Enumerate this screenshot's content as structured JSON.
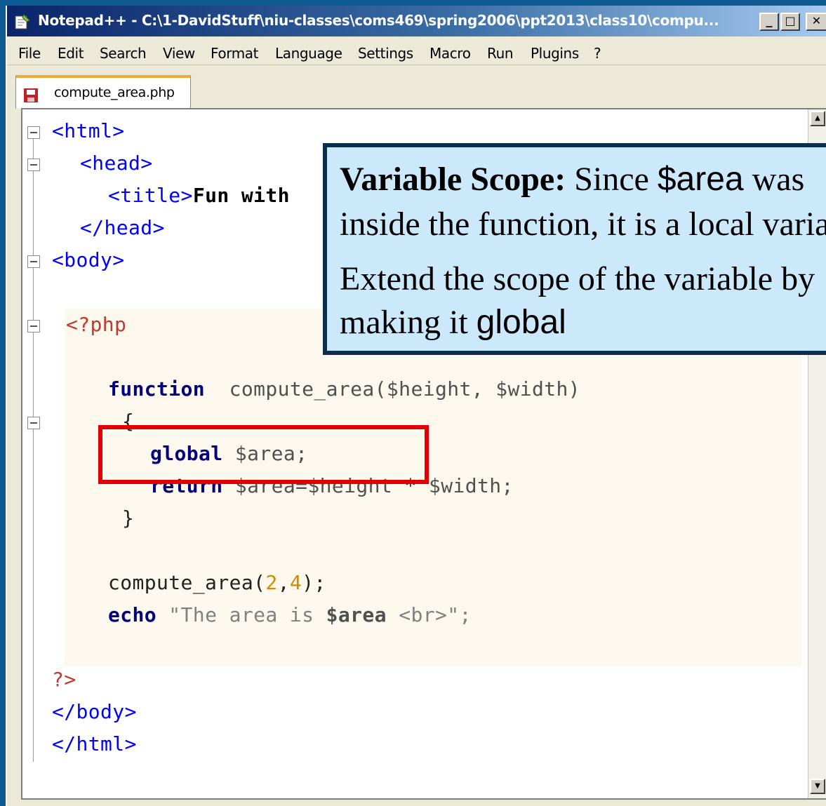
{
  "window": {
    "title": "Notepad++ - C:\\1-DavidStuff\\niu-classes\\coms469\\spring2006\\ppt2013\\class10\\compu...",
    "buttons": {
      "minimize": "_",
      "maximize": "□",
      "close": "✕"
    }
  },
  "menu": [
    "File",
    "Edit",
    "Search",
    "View",
    "Format",
    "Language",
    "Settings",
    "Macro",
    "Run",
    "Plugins",
    "?"
  ],
  "tab": {
    "label": "compute_area.php"
  },
  "code": {
    "l1": "<html>",
    "l2": "<head>",
    "l3_tag": "<title>",
    "l3_text": "Fun with",
    "l4": "</head>",
    "l5": "<body>",
    "l6": "<?php",
    "l7_kw": "function",
    "l7_rest": "compute_area($height, $width)",
    "l8": "{",
    "l9_kw": "global",
    "l9_rest": "$area;",
    "l10_kw": "return",
    "l10_rest": "$area=$height",
    "l10_op": "*",
    "l10_var": "$width;",
    "l11": "}",
    "l12_fn": "compute_area(",
    "l12_a": "2",
    "l12_comma": ",",
    "l12_b": "4",
    "l12_end": ");",
    "l13_kw": "echo",
    "l13_s1": "\"The area is ",
    "l13_var": "$area",
    "l13_s2": " <br>\";",
    "l14": "?>",
    "l15": "</body>",
    "l16": "</html>"
  },
  "callout": {
    "heading": "Variable Scope:",
    "line1_a": "Since",
    "line1_var": "$area",
    "line1_b": "was",
    "line2": "inside the function, it is a local variable.",
    "line3": "Extend the scope of the variable by",
    "line4_a": "making it",
    "line4_b": "global"
  },
  "colors": {
    "callout_bg": "#cce8fb",
    "callout_border": "#0b2d4e",
    "highlight": "#e00000",
    "desktop": "#0d5a92"
  }
}
